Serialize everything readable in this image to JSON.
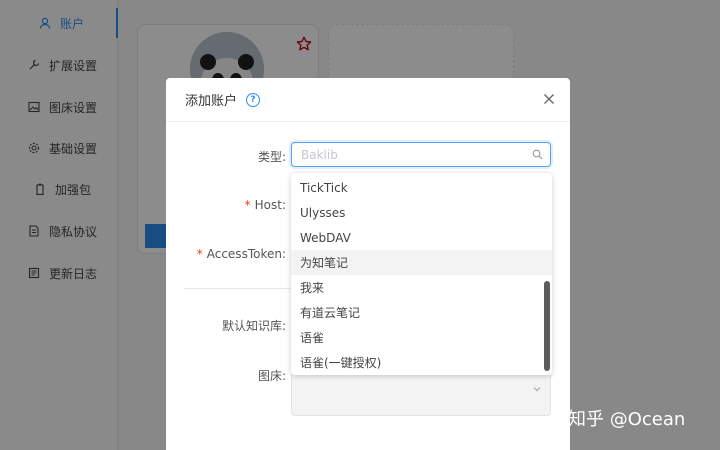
{
  "sidebar": {
    "items": [
      {
        "label": "账户",
        "icon": "user-icon"
      },
      {
        "label": "扩展设置",
        "icon": "wrench-icon"
      },
      {
        "label": "图床设置",
        "icon": "image-icon"
      },
      {
        "label": "基础设置",
        "icon": "gear-icon"
      },
      {
        "label": "加强包",
        "icon": "battery-icon"
      },
      {
        "label": "隐私协议",
        "icon": "document-icon"
      },
      {
        "label": "更新日志",
        "icon": "log-icon"
      }
    ],
    "accent": "#2d8cf0"
  },
  "modal": {
    "title": "添加账户",
    "fields": {
      "type": {
        "label": "类型:",
        "placeholder": "Baklib"
      },
      "host": {
        "label": "Host:"
      },
      "token": {
        "label": "AccessToken:"
      },
      "default_repo": {
        "label": "默认知识库:"
      },
      "image_bed": {
        "label": "图床:"
      }
    },
    "required_mark": "*"
  },
  "dropdown": {
    "options": [
      "TickTick",
      "Ulysses",
      "WebDAV",
      "为知笔记",
      "我来",
      "有道云笔记",
      "语雀",
      "语雀(一键授权)"
    ],
    "hovered": "为知笔记"
  },
  "watermark": "知乎 @Ocean"
}
